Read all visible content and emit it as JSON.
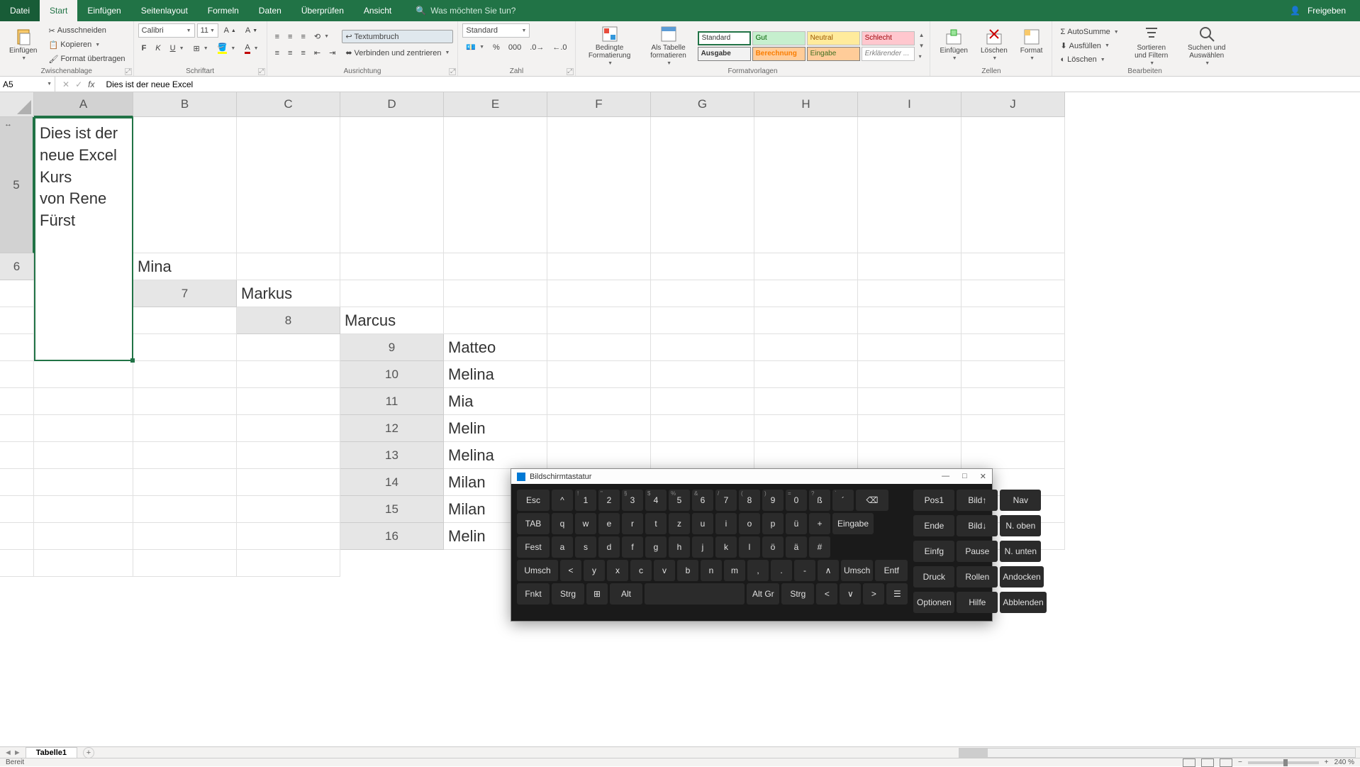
{
  "titlebar": {
    "tabs": [
      "Datei",
      "Start",
      "Einfügen",
      "Seitenlayout",
      "Formeln",
      "Daten",
      "Überprüfen",
      "Ansicht"
    ],
    "active": "Start",
    "search_placeholder": "Was möchten Sie tun?",
    "share": "Freigeben"
  },
  "ribbon": {
    "clipboard": {
      "label": "Zwischenablage",
      "paste": "Einfügen",
      "cut": "Ausschneiden",
      "copy": "Kopieren",
      "format_painter": "Format übertragen"
    },
    "font": {
      "label": "Schriftart",
      "name": "Calibri",
      "size": "11"
    },
    "alignment": {
      "label": "Ausrichtung",
      "wrap": "Textumbruch",
      "merge": "Verbinden und zentrieren"
    },
    "number": {
      "label": "Zahl",
      "format": "Standard"
    },
    "styles": {
      "label": "Formatvorlagen",
      "cond": "Bedingte Formatierung",
      "table": "Als Tabelle formatieren",
      "gallery": [
        "Standard",
        "Gut",
        "Neutral",
        "Schlecht",
        "Ausgabe",
        "Berechnung",
        "Eingabe",
        "Erklärender ..."
      ]
    },
    "cells": {
      "label": "Zellen",
      "insert": "Einfügen",
      "delete": "Löschen",
      "format": "Format"
    },
    "editing": {
      "label": "Bearbeiten",
      "sum": "AutoSumme",
      "fill": "Ausfüllen",
      "clear": "Löschen",
      "sort": "Sortieren und Filtern",
      "find": "Suchen und Auswählen"
    }
  },
  "formula": {
    "name_box": "A5",
    "value": "Dies ist der neue Excel"
  },
  "columns": [
    "A",
    "B",
    "C",
    "D",
    "E",
    "F",
    "G",
    "H",
    "I",
    "J"
  ],
  "merged_rows": 5,
  "a5_text": "Dies ist der\nneue Excel\nKurs\nvon Rene\nFürst",
  "rows": [
    {
      "n": 6,
      "a": "Mina"
    },
    {
      "n": 7,
      "a": "Markus"
    },
    {
      "n": 8,
      "a": "Marcus"
    },
    {
      "n": 9,
      "a": "Matteo"
    },
    {
      "n": 10,
      "a": "Melina"
    },
    {
      "n": 11,
      "a": "Mia"
    },
    {
      "n": 12,
      "a": "Melin"
    },
    {
      "n": 13,
      "a": "Melina"
    },
    {
      "n": 14,
      "a": "Milan"
    },
    {
      "n": 15,
      "a": "Milan"
    },
    {
      "n": 16,
      "a": "Melin"
    }
  ],
  "sheet": {
    "tab": "Tabelle1"
  },
  "status": {
    "ready": "Bereit",
    "zoom": "240 %"
  },
  "osk": {
    "title": "Bildschirmtastatur",
    "row1": [
      "Esc",
      "^",
      "1",
      "2",
      "3",
      "4",
      "5",
      "6",
      "7",
      "8",
      "9",
      "0",
      "ß",
      "´",
      "⌫"
    ],
    "row1_sup": [
      "",
      "",
      "!",
      "\"",
      "§",
      "$",
      "%",
      "&",
      "/",
      "(",
      ")",
      "=",
      "?",
      "`",
      ""
    ],
    "row2": [
      "TAB",
      "q",
      "w",
      "e",
      "r",
      "t",
      "z",
      "u",
      "i",
      "o",
      "p",
      "ü",
      "+",
      "Eingabe"
    ],
    "row3": [
      "Fest",
      "a",
      "s",
      "d",
      "f",
      "g",
      "h",
      "j",
      "k",
      "l",
      "ö",
      "ä",
      "#"
    ],
    "row4": [
      "Umsch",
      "<",
      "y",
      "x",
      "c",
      "v",
      "b",
      "n",
      "m",
      ",",
      ".",
      "-",
      "∧",
      "Umsch",
      "Entf"
    ],
    "row5": [
      "Fnkt",
      "Strg",
      "⊞",
      "Alt",
      " ",
      "Alt Gr",
      "Strg",
      "<",
      "∨",
      ">",
      "☰"
    ],
    "nav": [
      [
        "Pos1",
        "Bild↑",
        "Nav"
      ],
      [
        "Ende",
        "Bild↓",
        "N. oben"
      ],
      [
        "Einfg",
        "Pause",
        "N. unten"
      ],
      [
        "Druck",
        "Rollen",
        "Andocken"
      ],
      [
        "Optionen",
        "Hilfe",
        "Abblenden"
      ]
    ]
  }
}
